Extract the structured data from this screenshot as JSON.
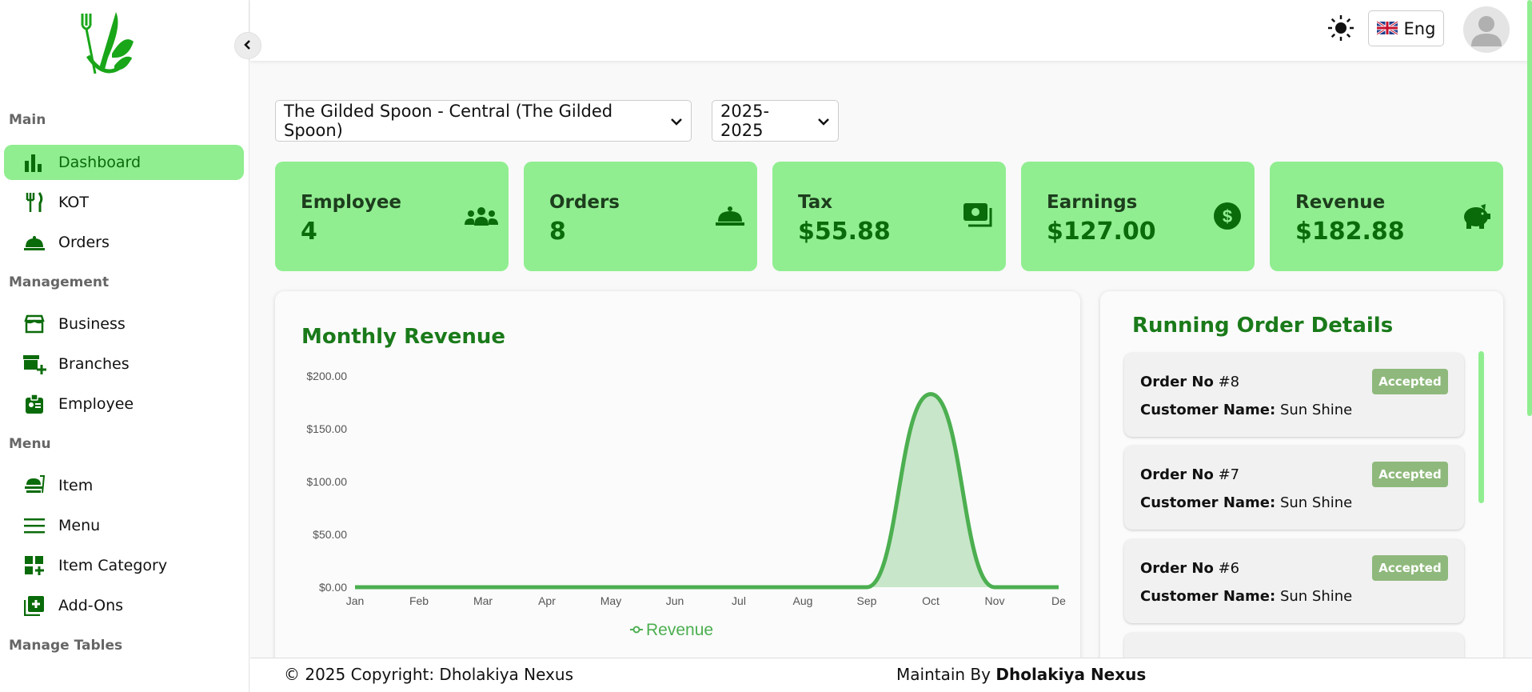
{
  "sidebar": {
    "sections": [
      "Main",
      "Management",
      "Menu",
      "Manage Tables"
    ],
    "items": [
      {
        "label": "Dashboard",
        "icon": "bar-chart-icon",
        "active": true
      },
      {
        "label": "KOT",
        "icon": "utensils-icon"
      },
      {
        "label": "Orders",
        "icon": "cloche-icon"
      },
      {
        "label": "Business",
        "icon": "store-icon"
      },
      {
        "label": "Branches",
        "icon": "store-add-icon"
      },
      {
        "label": "Employee",
        "icon": "id-badge-icon"
      },
      {
        "label": "Item",
        "icon": "food-item-icon"
      },
      {
        "label": "Menu",
        "icon": "menu-lines-icon"
      },
      {
        "label": "Item Category",
        "icon": "category-grid-icon"
      },
      {
        "label": "Add-Ons",
        "icon": "plus-box-icon"
      }
    ]
  },
  "header": {
    "language": "Eng",
    "theme_icon": "sun-icon"
  },
  "filters": {
    "branch": "The Gilded Spoon - Central (The Gilded Spoon)",
    "year": "2025-2025"
  },
  "stats": [
    {
      "title": "Employee",
      "value": "4",
      "icon": "users-icon"
    },
    {
      "title": "Orders",
      "value": "8",
      "icon": "cloche-icon"
    },
    {
      "title": "Tax",
      "value": "$55.88",
      "icon": "money-icon"
    },
    {
      "title": "Earnings",
      "value": "$127.00",
      "icon": "dollar-circle-icon"
    },
    {
      "title": "Revenue",
      "value": "$182.88",
      "icon": "piggy-bank-icon"
    }
  ],
  "chart_panel": {
    "title": "Monthly Revenue"
  },
  "chart_data": {
    "type": "area",
    "title": "Monthly Revenue",
    "categories": [
      "Jan",
      "Feb",
      "Mar",
      "Apr",
      "May",
      "Jun",
      "Jul",
      "Aug",
      "Sep",
      "Oct",
      "Nov",
      "De"
    ],
    "series": [
      {
        "name": "Revenue",
        "values": [
          0,
          0,
          0,
          0,
          0,
          0,
          0,
          0,
          0,
          182.88,
          0,
          0
        ]
      }
    ],
    "yticks": [
      "$0.00",
      "$50.00",
      "$100.00",
      "$150.00",
      "$200.00"
    ],
    "ylim": [
      0,
      200
    ],
    "color": "#4caf50",
    "fill": "#c8e6c9",
    "legend": "bottom"
  },
  "orders_panel": {
    "title": "Running Order Details",
    "order_label": "Order No",
    "customer_label": "Customer Name:",
    "orders": [
      {
        "no": "#8",
        "customer": "Sun Shine",
        "status": "Accepted"
      },
      {
        "no": "#7",
        "customer": "Sun Shine",
        "status": "Accepted"
      },
      {
        "no": "#6",
        "customer": "Sun Shine",
        "status": "Accepted"
      }
    ]
  },
  "footer": {
    "copyright": "© 2025 Copyright: Dholakiya Nexus",
    "maintain_prefix": "Maintain By",
    "maintain_name": "Dholakiya Nexus"
  },
  "colors": {
    "accent": "#90ee90",
    "brand_green": "#1a7a1a",
    "badge": "#8fb97c"
  }
}
